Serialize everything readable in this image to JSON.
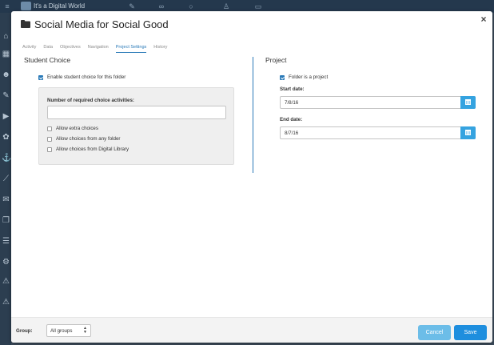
{
  "background": {
    "app_title": "It's a Digital World"
  },
  "modal": {
    "title": "Social Media for Social Good",
    "close_glyph": "×",
    "tabs": [
      {
        "label": "Activity",
        "active": false
      },
      {
        "label": "Data",
        "active": false
      },
      {
        "label": "Objectives",
        "active": false
      },
      {
        "label": "Navigation",
        "active": false
      },
      {
        "label": "Project Settings",
        "active": true
      },
      {
        "label": "History",
        "active": false
      }
    ]
  },
  "student_choice": {
    "title": "Student Choice",
    "enable_label": "Enable student choice for this folder",
    "enable_checked": true,
    "required_label": "Number of required choice activities:",
    "required_value": "",
    "options": [
      {
        "label": "Allow extra choices",
        "checked": false
      },
      {
        "label": "Allow choices from any folder",
        "checked": false
      },
      {
        "label": "Allow choices from Digital Library",
        "checked": false
      }
    ]
  },
  "project": {
    "title": "Project",
    "is_project_label": "Folder is a project",
    "is_project_checked": true,
    "start_label": "Start date:",
    "start_value": "7/8/16",
    "end_label": "End date:",
    "end_value": "8/7/16"
  },
  "footer": {
    "group_label": "Group:",
    "group_value": "All groups",
    "cancel_label": "Cancel",
    "save_label": "Save"
  },
  "colors": {
    "accent": "#2a7ab8",
    "calendar_button": "#35a3e0",
    "save_button": "#1e8ede",
    "cancel_button": "#6cbde8"
  }
}
